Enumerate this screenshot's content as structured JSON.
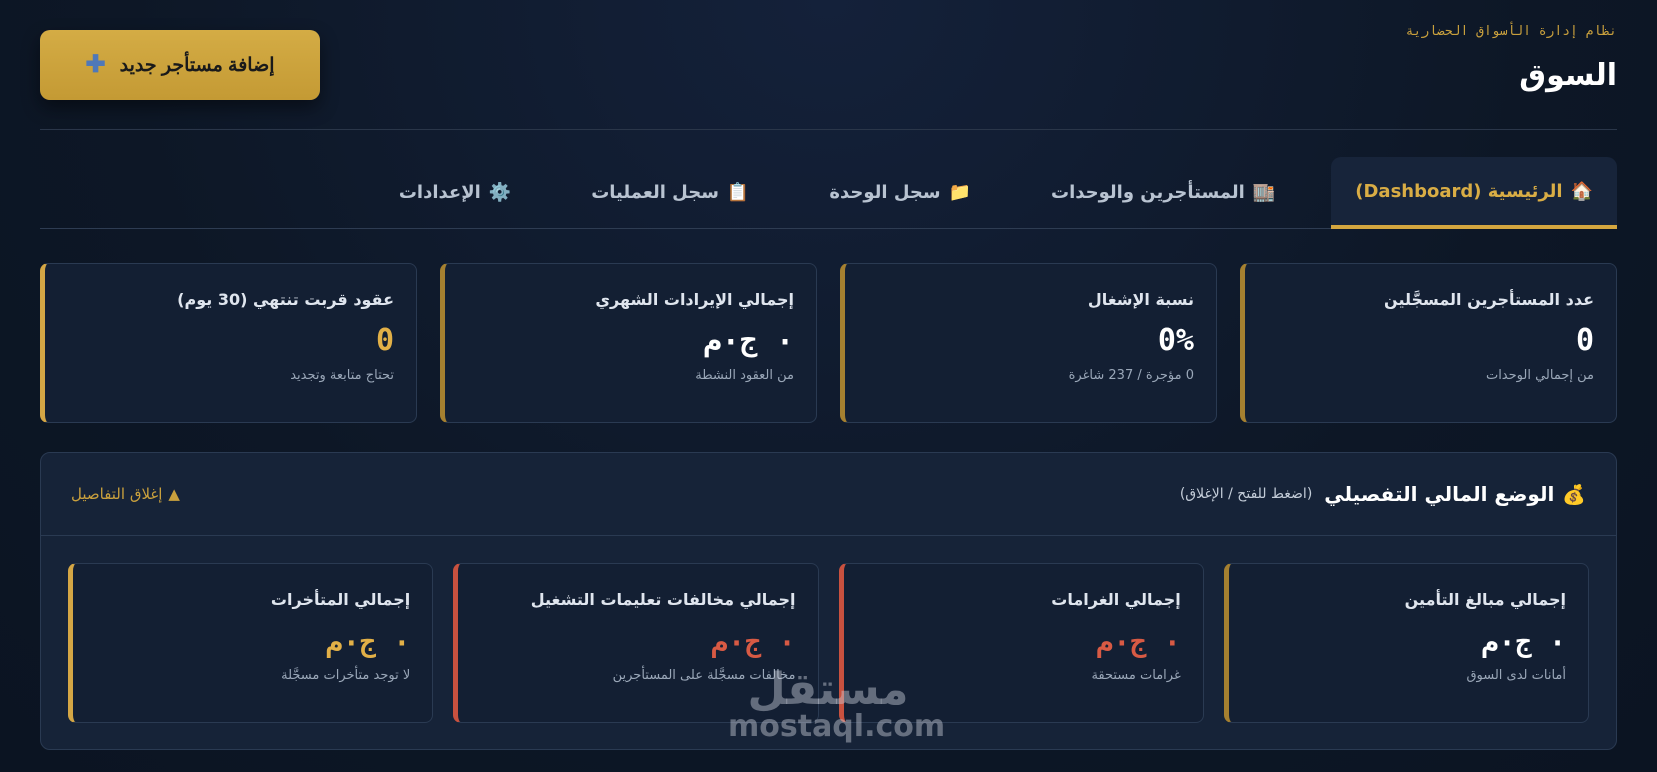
{
  "header": {
    "subtitle": "نظام إدارة الأسواق الحضارية",
    "title": "السوق",
    "add_button_label": "إضافة مستأجر جديد",
    "add_button_icon": "plus-icon"
  },
  "tabs": [
    {
      "icon": "🏠",
      "label": "الرئيسية (Dashboard)",
      "active": true
    },
    {
      "icon": "🏬",
      "label": "المستأجرين والوحدات",
      "active": false
    },
    {
      "icon": "📁",
      "label": "سجل الوحدة",
      "active": false
    },
    {
      "icon": "📋",
      "label": "سجل العمليات",
      "active": false
    },
    {
      "icon": "⚙️",
      "label": "الإعدادات",
      "active": false
    }
  ],
  "stats": [
    {
      "label": "عدد المستأجرين المسجَّلين",
      "value": "0",
      "sub": "من إجمالي الوحدات"
    },
    {
      "label": "نسبة الإشغال",
      "value": "0%",
      "sub": "0 مؤجرة / 237 شاغرة"
    },
    {
      "label": "إجمالي الإيرادات الشهري",
      "value": "٠ ج٠م",
      "sub": "من العقود النشطة"
    },
    {
      "label": "عقود قربت تنتهي (30 يوم)",
      "value": "0",
      "sub": "تحتاج متابعة وتجديد"
    }
  ],
  "financial": {
    "icon": "💰",
    "title": "الوضع المالي التفصيلي",
    "hint": "(اضغط للفتح / الإغلاق)",
    "toggle_icon": "▲",
    "toggle_label": "إغلاق التفاصيل",
    "cards": [
      {
        "label": "إجمالي مبالغ التأمين",
        "value": "٠ ج٠م",
        "sub": "أمانات لدى السوق"
      },
      {
        "label": "إجمالي الغرامات",
        "value": "٠ ج٠م",
        "sub": "غرامات مستحقة"
      },
      {
        "label": "إجمالي مخالفات تعليمات التشغيل",
        "value": "٠ ج٠م",
        "sub": "مخالفات مسجَّلة على المستأجرين"
      },
      {
        "label": "إجمالي المتأخرات",
        "value": "٠ ج٠م",
        "sub": "لا توجد متأخرات مسجَّلة"
      }
    ]
  },
  "watermark": {
    "arabic": "مستقل",
    "latin": "mostaql.com"
  },
  "colors": {
    "accent": "#d4a645",
    "danger": "#d85a44",
    "background": "#0d1726"
  }
}
